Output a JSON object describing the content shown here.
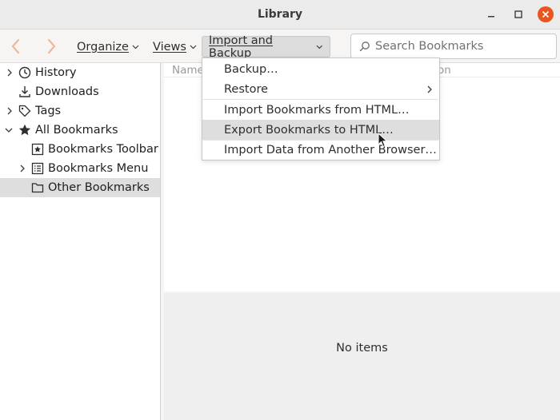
{
  "window": {
    "title": "Library"
  },
  "toolbar": {
    "organize_label": "Organize",
    "views_label": "Views",
    "import_backup_label": "Import and Backup",
    "search_placeholder": "Search Bookmarks"
  },
  "sidebar": {
    "items": [
      {
        "label": "History",
        "icon": "clock-icon",
        "expandable": true,
        "expanded": false
      },
      {
        "label": "Downloads",
        "icon": "download-icon",
        "expandable": false
      },
      {
        "label": "Tags",
        "icon": "tag-icon",
        "expandable": true,
        "expanded": false
      },
      {
        "label": "All Bookmarks",
        "icon": "star-icon",
        "expandable": true,
        "expanded": true
      },
      {
        "label": "Bookmarks Toolbar",
        "icon": "bookmarks-toolbar-icon",
        "expandable": false
      },
      {
        "label": "Bookmarks Menu",
        "icon": "bookmarks-menu-icon",
        "expandable": true,
        "expanded": false
      },
      {
        "label": "Other Bookmarks",
        "icon": "folder-icon",
        "expandable": false,
        "selected": true
      }
    ]
  },
  "content": {
    "columns": [
      "Name",
      "on"
    ],
    "empty_text": "No items"
  },
  "import_menu": {
    "items": [
      {
        "label": "Backup…",
        "accesskey": "B"
      },
      {
        "label": "Restore",
        "accesskey": "R",
        "submenu": true
      },
      {
        "label": "Import Bookmarks from HTML…",
        "accesskey": "I"
      },
      {
        "label": "Export Bookmarks to HTML…",
        "accesskey": "E",
        "hovered": true
      },
      {
        "label": "Import Data from Another Browser…",
        "accesskey": "A"
      }
    ]
  },
  "colors": {
    "close_button": "#e95420",
    "nav_arrow_disabled": "#f0b89a",
    "selected_row": "#dedede"
  }
}
